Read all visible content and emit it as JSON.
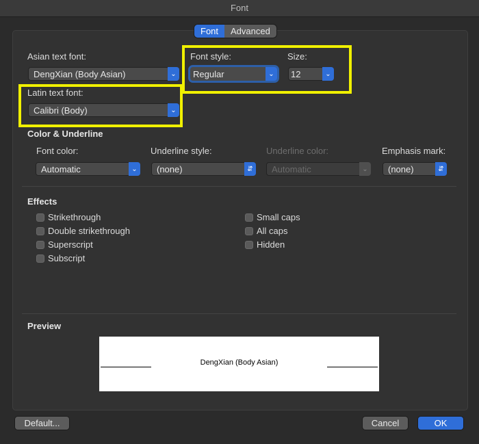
{
  "window": {
    "title": "Font"
  },
  "tabs": [
    {
      "label": "Font",
      "active": true
    },
    {
      "label": "Advanced",
      "active": false
    }
  ],
  "asian_font": {
    "label": "Asian text font:",
    "value": "DengXian (Body Asian)"
  },
  "latin_font": {
    "label": "Latin text font:",
    "value": "Calibri (Body)"
  },
  "font_style": {
    "label": "Font style:",
    "value": "Regular"
  },
  "size": {
    "label": "Size:",
    "value": "12"
  },
  "color_section": {
    "title": "Color & Underline",
    "font_color": {
      "label": "Font color:",
      "value": "Automatic"
    },
    "underline_style": {
      "label": "Underline style:",
      "value": "(none)"
    },
    "underline_color": {
      "label": "Underline color:",
      "value": "Automatic"
    },
    "emphasis_mark": {
      "label": "Emphasis mark:",
      "value": "(none)"
    }
  },
  "effects": {
    "title": "Effects",
    "left": [
      "Strikethrough",
      "Double strikethrough",
      "Superscript",
      "Subscript"
    ],
    "right": [
      "Small caps",
      "All caps",
      "Hidden"
    ]
  },
  "preview": {
    "title": "Preview",
    "sample": "DengXian (Body Asian)"
  },
  "buttons": {
    "default": "Default...",
    "cancel": "Cancel",
    "ok": "OK"
  },
  "colors": {
    "accent": "#2f6ed8",
    "highlight": "#f0f000",
    "background": "#2b2b2b"
  }
}
